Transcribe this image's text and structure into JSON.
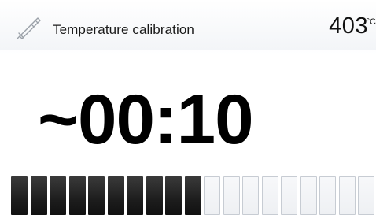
{
  "header": {
    "title": "Temperature calibration",
    "temperature_value": "403",
    "temperature_unit": "°C",
    "icon": "thermocouple-probe-icon"
  },
  "main": {
    "timer": "~00:10"
  },
  "progress": {
    "total_segments": 20,
    "filled_segments": 10,
    "fill_color": "#1d1d1d",
    "empty_color": "#eef0f3"
  }
}
